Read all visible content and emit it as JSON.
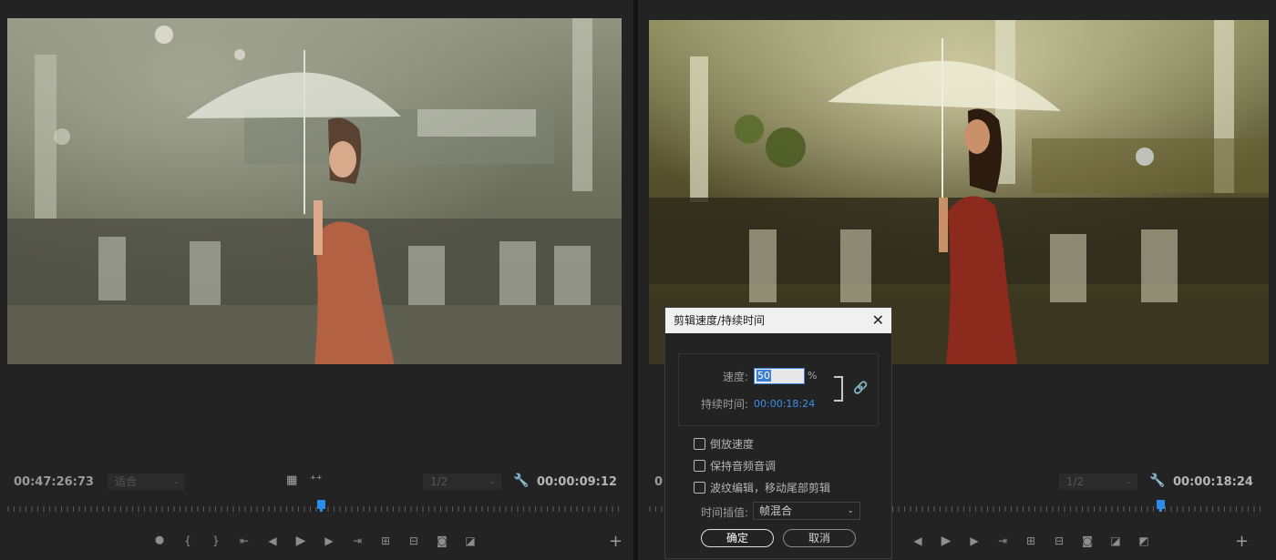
{
  "source_monitor": {
    "timecode": "00:47:26:73",
    "fit": "适合",
    "resolution": "1/2",
    "duration": "00:00:09:12",
    "icons": [
      "marker-icon",
      "mark-in-icon",
      "mark-out-icon",
      "go-to-in-icon",
      "step-back-icon",
      "play-icon",
      "step-forward-icon",
      "go-to-out-icon",
      "insert-icon",
      "overwrite-icon",
      "export-frame-icon",
      "compare-icon"
    ]
  },
  "program_monitor": {
    "timecode": "0",
    "resolution": "1/2",
    "duration": "00:00:18:24"
  },
  "dialog": {
    "title": "剪辑速度/持续时间",
    "speed_label": "速度:",
    "speed_value": "50",
    "speed_unit": "%",
    "duration_label": "持续时间:",
    "duration_value": "00:00:18:24",
    "reverse_label": "倒放速度",
    "maintain_pitch_label": "保持音频音调",
    "ripple_label": "波纹编辑，移动尾部剪辑",
    "interp_label": "时间插值:",
    "interp_value": "帧混合",
    "ok_label": "确定",
    "cancel_label": "取消"
  },
  "colors": {
    "accent": "#2d8ceb",
    "panel": "#232323",
    "dialog_title_bg": "#f0f0f0"
  }
}
